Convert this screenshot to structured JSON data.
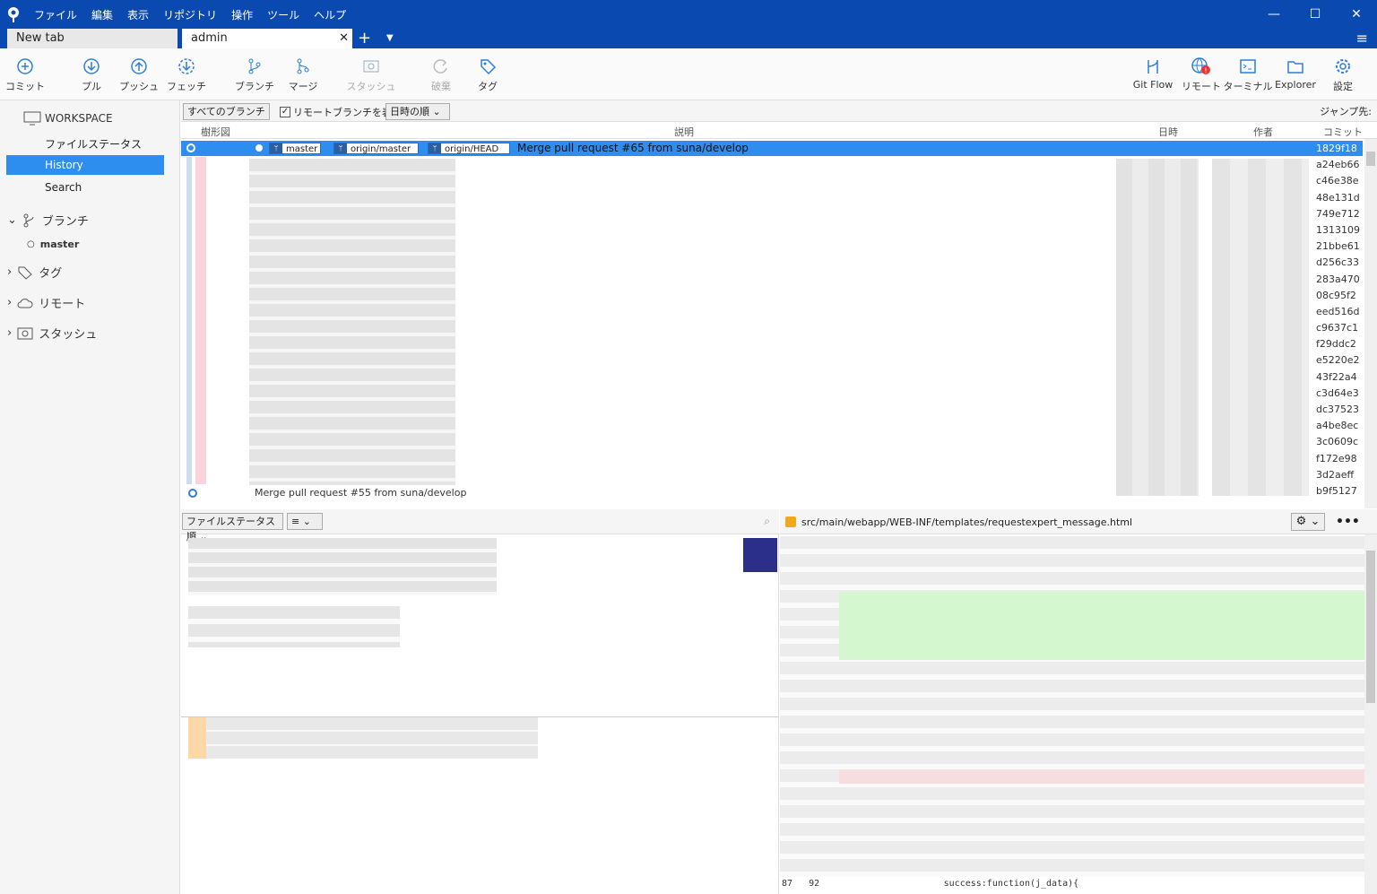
{
  "menu": [
    "ファイル",
    "編集",
    "表示",
    "リポジトリ",
    "操作",
    "ツール",
    "ヘルプ"
  ],
  "tabs": {
    "new_tab": "New tab",
    "admin": "admin"
  },
  "toolbar": {
    "commit": "コミット",
    "pull": "プル",
    "push": "プッシュ",
    "fetch": "フェッチ",
    "branch": "ブランチ",
    "merge": "マージ",
    "stash": "スタッシュ",
    "discard": "破棄",
    "tag": "タグ",
    "gitflow": "Git Flow",
    "remote": "リモート",
    "terminal": "ターミナル",
    "explorer": "Explorer",
    "settings": "設定"
  },
  "sidebar": {
    "workspace": "WORKSPACE",
    "file_status": "ファイルステータス",
    "history": "History",
    "search": "Search",
    "branches": "ブランチ",
    "master": "master",
    "tags": "タグ",
    "remotes": "リモート",
    "stashes": "スタッシュ"
  },
  "filter": {
    "all_branches": "すべてのブランチ",
    "show_remote": "リモートブランチを表示",
    "order": "日時の順",
    "jump": "ジャンプ先:"
  },
  "columns": {
    "graph": "樹形図",
    "description": "説明",
    "date": "日時",
    "author": "作者",
    "commit": "コミット"
  },
  "selected": {
    "refs": [
      "master",
      "origin/master",
      "origin/HEAD"
    ],
    "message": "Merge pull request #65 from suna/develop"
  },
  "hashes": [
    "1829f18",
    "a24eb66",
    "c46e38e",
    "48e131d",
    "749e712",
    "1313109",
    "21bbe61",
    "d256c33",
    "283a470",
    "08c95f2",
    "eed516d",
    "c9637c1",
    "f29ddc2",
    "e5220e2",
    "43f22a4",
    "c3d64e3",
    "dc37523",
    "a4be8ec",
    "3c0609c",
    "f172e98",
    "3d2aeff",
    "b9f5127"
  ],
  "last_message": "Merge pull request #55 from suna/develop",
  "bottom": {
    "file_order": "ファイルステータス順",
    "list_icon": "≡"
  },
  "diff": {
    "path": "src/main/webapp/WEB-INF/templates/requestexpert_message.html",
    "line_a": "87",
    "line_b": "92",
    "code": "success:function(j_data){"
  }
}
